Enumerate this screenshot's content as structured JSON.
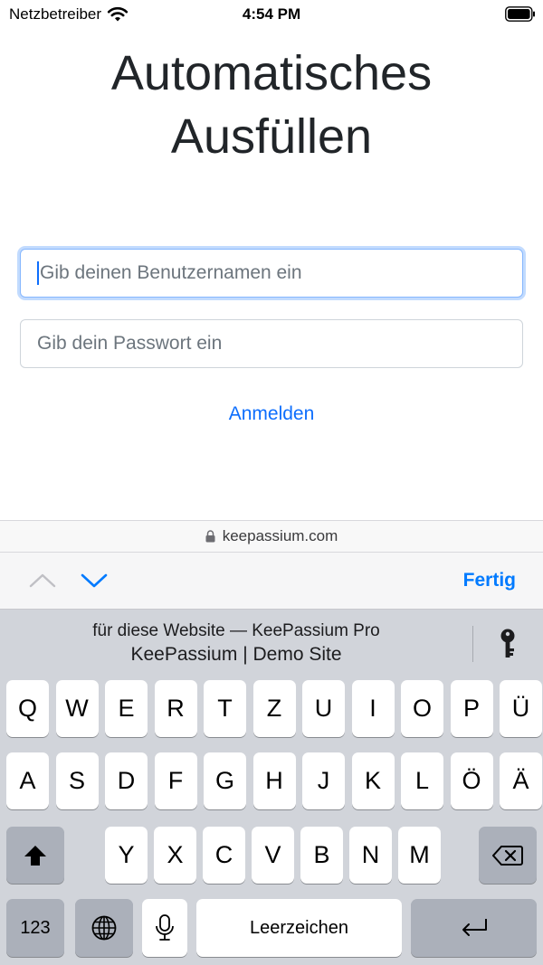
{
  "status_bar": {
    "carrier": "Netzbetreiber",
    "time": "4:54 PM"
  },
  "page": {
    "title_line1": "Automatisches",
    "title_line2": "Ausfüllen",
    "username_placeholder": "Gib deinen Benutzernamen ein",
    "password_placeholder": "Gib dein Passwort ein",
    "login_label": "Anmelden"
  },
  "browser": {
    "domain": "keepassium.com"
  },
  "accessory": {
    "done_label": "Fertig"
  },
  "keyboard": {
    "suggestion_line1": "für diese Website — KeePassium Pro",
    "suggestion_line2": "KeePassium | Demo Site",
    "row1": [
      "Q",
      "W",
      "E",
      "R",
      "T",
      "Z",
      "U",
      "I",
      "O",
      "P",
      "Ü"
    ],
    "row2": [
      "A",
      "S",
      "D",
      "F",
      "G",
      "H",
      "J",
      "K",
      "L",
      "Ö",
      "Ä"
    ],
    "row3": [
      "Y",
      "X",
      "C",
      "V",
      "B",
      "N",
      "M"
    ],
    "numbers_label": "123",
    "space_label": "Leerzeichen"
  },
  "colors": {
    "accent": "#007aff",
    "link": "#0d6efd",
    "keyboard_bg": "#d1d4da"
  },
  "icons": [
    "wifi-icon",
    "battery-icon",
    "lock-icon",
    "chevron-up-icon",
    "chevron-down-icon",
    "key-icon",
    "shift-icon",
    "backspace-icon",
    "globe-icon",
    "microphone-icon",
    "return-icon"
  ]
}
